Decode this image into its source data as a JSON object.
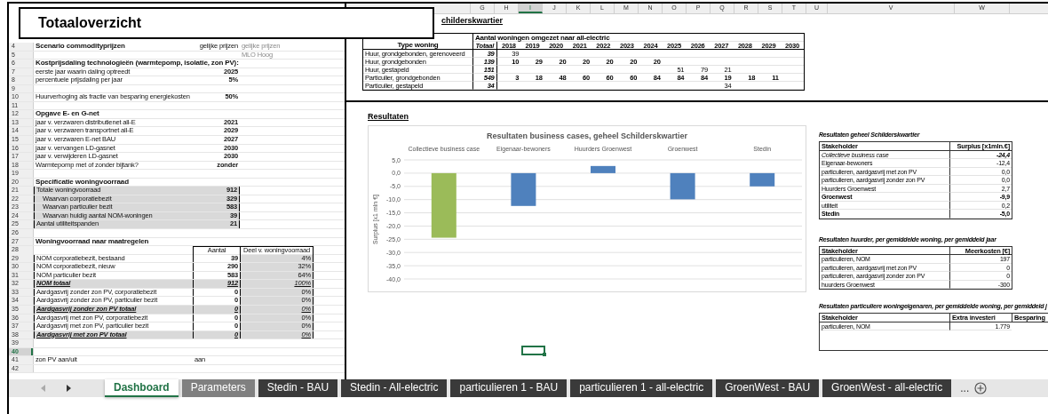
{
  "title": "Totaaloverzicht",
  "column_headers": [
    {
      "label": "G",
      "selected": false
    },
    {
      "label": "H",
      "selected": false
    },
    {
      "label": "I",
      "selected": true
    },
    {
      "label": "J",
      "selected": false
    },
    {
      "label": "K",
      "selected": false
    },
    {
      "label": "L",
      "selected": false
    },
    {
      "label": "M",
      "selected": false
    },
    {
      "label": "N",
      "selected": false
    },
    {
      "label": "O",
      "selected": false
    },
    {
      "label": "P",
      "selected": false
    },
    {
      "label": "Q",
      "selected": false
    },
    {
      "label": "R",
      "selected": false
    },
    {
      "label": "S",
      "selected": false
    },
    {
      "label": "T",
      "selected": false
    },
    {
      "label": "U",
      "selected": false
    },
    {
      "label": "V",
      "selected": false
    },
    {
      "label": "W",
      "selected": false
    }
  ],
  "settings_rows": [
    {
      "number": "4",
      "kind": "section",
      "label": "Scenario commodityprijzen",
      "value": "gelijke prijzen",
      "hint": "gelijke prijzen",
      "selected": false
    },
    {
      "number": "5",
      "kind": "blank",
      "hint": "MLO Hoog",
      "selected": false
    },
    {
      "number": "6",
      "kind": "section",
      "label": "Kostprijsdaling technologieën (warmtepomp, isolatie, zon PV):",
      "selected": false
    },
    {
      "number": "7",
      "kind": "setting",
      "label": "eerste jaar waarin daling optreedt",
      "value": "2025",
      "selected": false
    },
    {
      "number": "8",
      "kind": "setting",
      "label": "percentuele prijsdaling per jaar",
      "value": "5%",
      "selected": false
    },
    {
      "number": "9",
      "kind": "blank",
      "selected": false
    },
    {
      "number": "10",
      "kind": "setting",
      "label": "Huurverhoging als fractie van besparing energiekosten",
      "value": "50%",
      "selected": false
    },
    {
      "number": "11",
      "kind": "blank",
      "selected": false
    },
    {
      "number": "12",
      "kind": "section",
      "label": "Opgave E- en G-net",
      "selected": false
    },
    {
      "number": "13",
      "kind": "setting",
      "label": "jaar v. verzwaren distributienet all-E",
      "value": "2021",
      "selected": false
    },
    {
      "number": "14",
      "kind": "setting",
      "label": "jaar v. verzwaren transportnet all-E",
      "value": "2029",
      "selected": false
    },
    {
      "number": "15",
      "kind": "setting",
      "label": "jaar v. verzwaren E-net BAU",
      "value": "2027",
      "selected": false
    },
    {
      "number": "16",
      "kind": "setting",
      "label": "jaar v. vervangen LD-gasnet",
      "value": "2030",
      "selected": false
    },
    {
      "number": "17",
      "kind": "setting",
      "label": "jaar v. verwijderen LD-gasnet",
      "value": "2030",
      "selected": false
    },
    {
      "number": "18",
      "kind": "setting",
      "label": "Warmtepomp met of zonder bijtank?",
      "value": "zonder",
      "selected": false
    },
    {
      "number": "19",
      "kind": "blank",
      "selected": false
    },
    {
      "number": "20",
      "kind": "section",
      "label": "Specificatie woningvoorraad",
      "selected": false
    },
    {
      "number": "21",
      "kind": "stock",
      "label": "Totale woningvoorraad",
      "value": "912",
      "selected": false
    },
    {
      "number": "22",
      "kind": "stock_part",
      "label": "Waarvan corporatiebezit",
      "value": "329",
      "selected": false
    },
    {
      "number": "23",
      "kind": "stock_part",
      "label": "Waarvan particulier bezit",
      "value": "583",
      "selected": false
    },
    {
      "number": "24",
      "kind": "stock_part",
      "label": "Waarvan huidig aantal NOM-woningen",
      "value": "39",
      "selected": false
    },
    {
      "number": "25",
      "kind": "stock",
      "label": "Aantal utiliteitspanden",
      "value": "21",
      "selected": false
    },
    {
      "number": "26",
      "kind": "blank",
      "selected": false
    },
    {
      "number": "27",
      "kind": "section",
      "label": "Woningvoorraad naar maatregelen",
      "selected": false
    },
    {
      "number": "28",
      "kind": "header",
      "value": "Aantal",
      "share": "Deel v. woningvoorraad",
      "selected": false
    },
    {
      "number": "29",
      "kind": "measure",
      "label": "NOM corporatiebezit, bestaand",
      "value": "39",
      "share": "4%",
      "selected": false
    },
    {
      "number": "30",
      "kind": "measure",
      "label": "NOM corporatiebezit, nieuw",
      "value": "290",
      "share": "32%",
      "selected": false
    },
    {
      "number": "31",
      "kind": "measure",
      "label": "NOM particulier bezit",
      "value": "583",
      "share": "64%",
      "selected": false
    },
    {
      "number": "32",
      "kind": "total",
      "label": "NOM totaal",
      "value": "912",
      "share": "100%",
      "selected": false
    },
    {
      "number": "33",
      "kind": "measure",
      "label": "Aardgasvrij zonder zon PV, corporatiebezit",
      "value": "0",
      "share": "0%",
      "selected": false
    },
    {
      "number": "34",
      "kind": "measure",
      "label": "Aardgasvrij zonder zon PV, particulier bezit",
      "value": "0",
      "share": "0%",
      "selected": false
    },
    {
      "number": "35",
      "kind": "total",
      "label": "Aardgasvrij zonder zon PV totaal",
      "value": "0",
      "share": "0%",
      "selected": false
    },
    {
      "number": "36",
      "kind": "measure",
      "label": "Aardgasvrij met zon PV, corporatiebezit",
      "value": "0",
      "share": "0%",
      "selected": false
    },
    {
      "number": "37",
      "kind": "measure",
      "label": "Aardgasvrij met zon PV, particulier bezit",
      "value": "0",
      "share": "0%",
      "selected": false
    },
    {
      "number": "38",
      "kind": "total",
      "label": "Aardgasvrij met zon PV totaal",
      "value": "0",
      "share": "0%",
      "selected": false
    },
    {
      "number": "39",
      "kind": "blank",
      "selected": false
    },
    {
      "number": "40",
      "kind": "blank",
      "selected": true
    },
    {
      "number": "41",
      "kind": "switch",
      "label": "zon PV aan/uit",
      "value": "aan",
      "selected": false
    },
    {
      "number": "42",
      "kind": "blank",
      "selected": false
    }
  ],
  "housing_table": {
    "title": "childerskwartier",
    "header": "Type woning",
    "group_label": "Aantal woningen omgezet naar all-electric",
    "total_label": "Totaal",
    "years": [
      "2018",
      "2019",
      "2020",
      "2021",
      "2022",
      "2023",
      "2024",
      "2025",
      "2026",
      "2027",
      "2028",
      "2029",
      "2030"
    ],
    "rows": [
      {
        "label": "Huur, grondgebonden, gerenoveerd",
        "total": "39",
        "cells": [
          {
            "count": "39"
          },
          {
            "empty": true
          },
          {
            "empty": true
          },
          {
            "empty": true
          },
          {
            "empty": true
          },
          {
            "empty": true
          },
          {
            "empty": true
          },
          {
            "empty": true
          },
          {
            "empty": true
          },
          {
            "empty": true
          },
          {
            "empty": true
          },
          {
            "empty": true
          },
          {
            "empty": true
          }
        ]
      },
      {
        "label": "Huur, grondgebonden",
        "total": "139",
        "cells": [
          {
            "count": "10"
          },
          {
            "count": "29"
          },
          {
            "count": "20"
          },
          {
            "count": "20"
          },
          {
            "count": "20"
          },
          {
            "count": "20"
          },
          {
            "count": "20"
          },
          {
            "empty": true
          },
          {
            "empty": true
          },
          {
            "empty": true
          },
          {
            "empty": true
          },
          {
            "empty": true
          },
          {
            "empty": true
          }
        ]
      },
      {
        "label": "Huur, gestapeld",
        "total": "151",
        "cells": [
          {
            "empty": true
          },
          {
            "empty": true
          },
          {
            "empty": true
          },
          {
            "empty": true
          },
          {
            "empty": true
          },
          {
            "empty": true
          },
          {
            "empty": true
          },
          {
            "count": "51"
          },
          {
            "count": "79"
          },
          {
            "count": "21"
          },
          {
            "empty": true
          },
          {
            "empty": true
          },
          {
            "empty": true
          }
        ]
      },
      {
        "label": "Particulier, grondgebonden",
        "total": "549",
        "cells": [
          {
            "count": "3"
          },
          {
            "count": "18"
          },
          {
            "count": "48"
          },
          {
            "count": "60"
          },
          {
            "count": "60"
          },
          {
            "count": "60"
          },
          {
            "count": "84"
          },
          {
            "count": "84"
          },
          {
            "count": "84"
          },
          {
            "count": "19"
          },
          {
            "count": "18"
          },
          {
            "count": "11"
          },
          {
            "empty": true
          }
        ]
      },
      {
        "label": "Particulier, gestapeld",
        "total": "34",
        "cells": [
          {
            "empty": true
          },
          {
            "empty": true
          },
          {
            "empty": true
          },
          {
            "empty": true
          },
          {
            "empty": true
          },
          {
            "empty": true
          },
          {
            "empty": true
          },
          {
            "empty": true
          },
          {
            "empty": true
          },
          {
            "count": "34"
          },
          {
            "empty": true
          },
          {
            "empty": true
          },
          {
            "empty": true
          }
        ]
      }
    ]
  },
  "results": {
    "heading": "Resultaten",
    "chart_data": {
      "type": "bar",
      "title": "Resultaten business cases, geheel Schilderskwartier",
      "ylabel": "Surplus [x1 mln €]",
      "categories": [
        "Collectieve business case",
        "Eigenaar-bewoners",
        "Huurders Groenwest",
        "Groenwest",
        "Stedin"
      ],
      "stacked": true,
      "grid": true,
      "series": [
        {
          "color": "#9bbb59",
          "values": [
            -24.4,
            null,
            null,
            null,
            null
          ]
        },
        {
          "color": "#4f81bd",
          "values": [
            null,
            -12.4,
            2.7,
            -9.9,
            -5.0
          ]
        }
      ],
      "ylim": [
        -40,
        5
      ],
      "yticks": [
        {
          "value": 5,
          "label": "5,0"
        },
        {
          "value": 0,
          "label": "0,0"
        },
        {
          "value": -5,
          "label": "-5,0"
        },
        {
          "value": -10,
          "label": "-10,0"
        },
        {
          "value": -15,
          "label": "-15,0"
        },
        {
          "value": -20,
          "label": "-20,0"
        },
        {
          "value": -25,
          "label": "-25,0"
        },
        {
          "value": -30,
          "label": "-30,0"
        },
        {
          "value": -35,
          "label": "-35,0"
        },
        {
          "value": -40,
          "label": "-40,0"
        }
      ]
    }
  },
  "stakeholder_tables": [
    {
      "caption": "Resultaten geheel Schilderskwartier",
      "columns": [
        "Stakeholder",
        "Surplus [x1mln.€]"
      ],
      "rows": [
        {
          "kind": "summary",
          "cells": [
            "Collectieve business case",
            "-24,4"
          ]
        },
        {
          "kind": "plain",
          "cells": [
            "Eigenaar-bewoners",
            "-12,4"
          ]
        },
        {
          "kind": "plain",
          "cells": [
            "particulieren, aardgasvrij met zon PV",
            "0,0"
          ]
        },
        {
          "kind": "plain",
          "cells": [
            "particulieren, aardgasvrij zonder zon PV",
            "0,0"
          ]
        },
        {
          "kind": "plain",
          "cells": [
            "Huurders Groenwest",
            "2,7"
          ]
        },
        {
          "kind": "strong",
          "cells": [
            "Groenwest",
            "-9,9"
          ]
        },
        {
          "kind": "plain",
          "cells": [
            "utiliteit",
            "0,2"
          ]
        },
        {
          "kind": "strong",
          "cells": [
            "Stedin",
            "-5,0"
          ]
        }
      ]
    },
    {
      "caption": "Resultaten huurder, per gemiddelde woning, per gemiddeld jaar",
      "columns": [
        "Stakeholder",
        "Meerkosten [€]"
      ],
      "rows": [
        {
          "kind": "plain",
          "cells": [
            "particulieren, NOM",
            "197"
          ]
        },
        {
          "kind": "plain",
          "cells": [
            "particulieren, aardgasvrij met zon PV",
            "0"
          ]
        },
        {
          "kind": "plain",
          "cells": [
            "particulieren, aardgasvrij zonder zon PV",
            "0"
          ]
        },
        {
          "kind": "plain",
          "cells": [
            "huurders Groenwest",
            "-300"
          ]
        }
      ]
    },
    {
      "caption": "Resultaten particuliere woningeigenaren, per gemiddelde woning, per gemiddeld j",
      "columns": [
        "Stakeholder",
        "Extra investeri",
        "Besparing"
      ],
      "rows": [
        {
          "kind": "plain",
          "cells": [
            "particulieren, NOM",
            "1.779"
          ]
        }
      ]
    }
  ],
  "sheet_tabs": [
    {
      "label": "Dashboard",
      "selected": true,
      "color": "#ffffff"
    },
    {
      "label": "Parameters",
      "selected": false,
      "color": "#808080"
    },
    {
      "label": "Stedin - BAU",
      "selected": false,
      "color": "#3a3a3a"
    },
    {
      "label": "Stedin - All-electric",
      "selected": false,
      "color": "#3a3a3a"
    },
    {
      "label": "particulieren 1 - BAU",
      "selected": false,
      "color": "#3a3a3a"
    },
    {
      "label": "particulieren 1 - all-electric",
      "selected": false,
      "color": "#3a3a3a"
    },
    {
      "label": "GroenWest - BAU",
      "selected": false,
      "color": "#3a3a3a"
    },
    {
      "label": "GroenWest - all-electric",
      "selected": false,
      "color": "#3a3a3a"
    }
  ],
  "more_tabs": "..."
}
